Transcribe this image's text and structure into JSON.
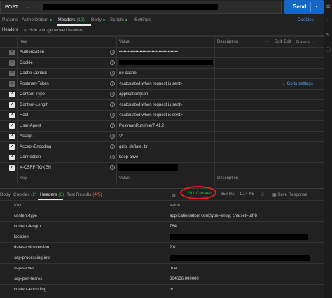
{
  "request": {
    "method": "POST",
    "send_label": "Send"
  },
  "tabs": {
    "params": "Params",
    "authorization": "Authorization",
    "headers": "Headers",
    "headers_count": "(12)",
    "body": "Body",
    "scripts": "Scripts",
    "settings": "Settings",
    "cookies": "Cookies"
  },
  "subbar": {
    "headers_label": "Headers",
    "hide_label": "Hide auto-generated headers"
  },
  "req_table": {
    "col_key": "Key",
    "col_value": "Value",
    "col_description": "Description",
    "bulk_edit": "Bulk Edit",
    "presets": "Presets",
    "go_to_settings": "Go to settings",
    "rows": [
      {
        "key": "Authorization",
        "value": "••••••••••••••••••••••••••••••••••••••••"
      },
      {
        "key": "Cookie",
        "value": ""
      },
      {
        "key": "Cache-Control",
        "value": "no-cache"
      },
      {
        "key": "Postman-Token",
        "value": "<calculated when request is sent>"
      },
      {
        "key": "Content-Type",
        "value": "application/json"
      },
      {
        "key": "Content-Length",
        "value": "<calculated when request is sent>"
      },
      {
        "key": "Host",
        "value": "<calculated when request is sent>"
      },
      {
        "key": "User-Agent",
        "value": "PostmanRuntime/7.41.2"
      },
      {
        "key": "Accept",
        "value": "*/*"
      },
      {
        "key": "Accept-Encoding",
        "value": "gzip, deflate, br"
      },
      {
        "key": "Connection",
        "value": "keep-alive"
      },
      {
        "key": "X-CSRF-TOKEN",
        "value": ""
      }
    ],
    "empty_key": "Key",
    "empty_value": "Value",
    "empty_description": "Description"
  },
  "response": {
    "body": "Body",
    "cookies": "Cookies",
    "cookies_count": "(2)",
    "headers": "Headers",
    "headers_count": "(8)",
    "test_results": "Test Results",
    "test_count": "(4/5)",
    "status": "201 Created",
    "time": "358 ms",
    "size": "1.14 KB",
    "save_response": "Save Response",
    "col_key": "Key",
    "col_value": "Value",
    "rows": [
      {
        "key": "content-type",
        "value": "application/atom+xml;type=entry; charset=utf-8"
      },
      {
        "key": "content-length",
        "value": "764"
      },
      {
        "key": "location",
        "value": ""
      },
      {
        "key": "dataserviceversion",
        "value": "2.0"
      },
      {
        "key": "sap-processing-info",
        "value": ""
      },
      {
        "key": "sap-server",
        "value": "true"
      },
      {
        "key": "sap-perf-fesrec",
        "value": "304636.000000"
      },
      {
        "key": "content-encoding",
        "value": "br"
      }
    ]
  }
}
